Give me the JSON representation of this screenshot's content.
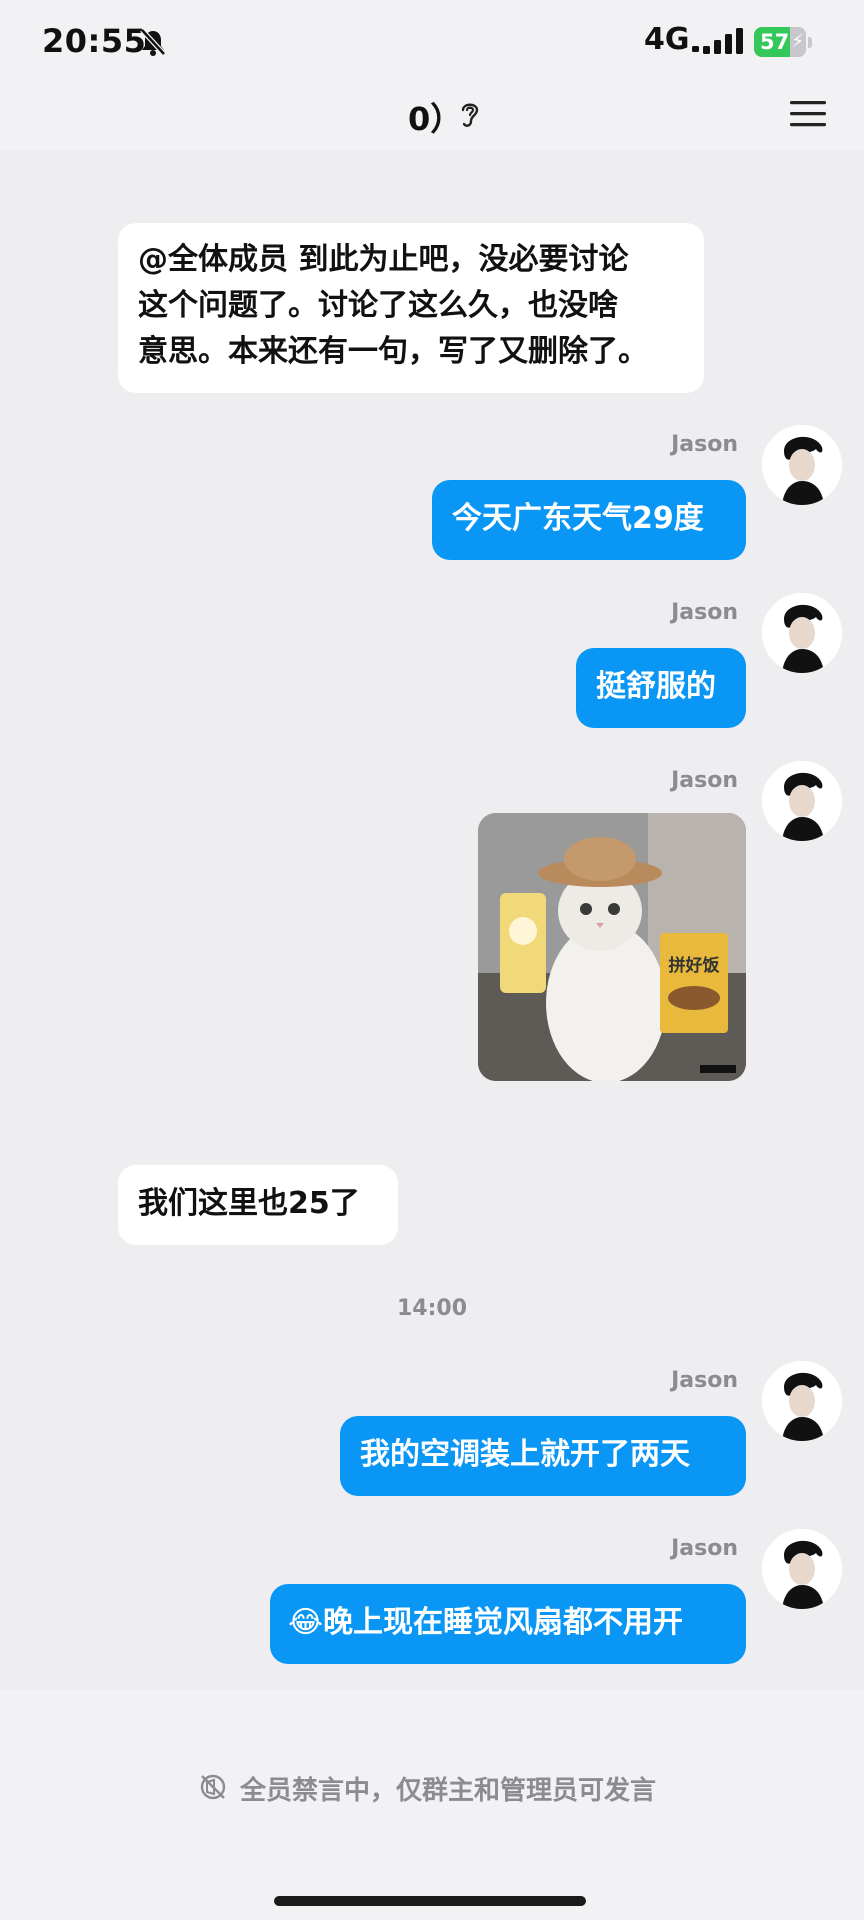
{
  "status_bar": {
    "time": "20:55",
    "network": "4G",
    "battery": "57"
  },
  "header": {
    "title": "0）"
  },
  "messages": [
    {
      "side": "left",
      "text": "@全体成员 到此为止吧，没必要讨论\n这个问题了。讨论了这么久，也没啥\n意思。本来还有一句，写了又删除了。"
    },
    {
      "side": "right",
      "sender": "Jason",
      "text": "今天广东天气29度"
    },
    {
      "side": "right",
      "sender": "Jason",
      "text": "挺舒服的"
    },
    {
      "side": "right",
      "sender": "Jason",
      "type": "sticker",
      "sticker_text": "拼好饭"
    },
    {
      "side": "left",
      "text": "我们这里也25了"
    },
    {
      "type": "time",
      "text": "14:00"
    },
    {
      "side": "right",
      "sender": "Jason",
      "text": "我的空调装上就开了两天"
    },
    {
      "side": "right",
      "sender": "Jason",
      "text": "😂晚上现在睡觉风扇都不用开"
    }
  ],
  "footer": {
    "notice": "全员禁言中，仅群主和管理员可发言"
  },
  "colors": {
    "bubble_right": "#0a96f5",
    "bubble_left": "#ffffff",
    "background": "#eeeef0",
    "battery": "#34c759"
  },
  "icons": [
    "bell-off-icon",
    "signal-icon",
    "battery-icon",
    "ear-icon",
    "menu-icon",
    "mute-icon"
  ]
}
